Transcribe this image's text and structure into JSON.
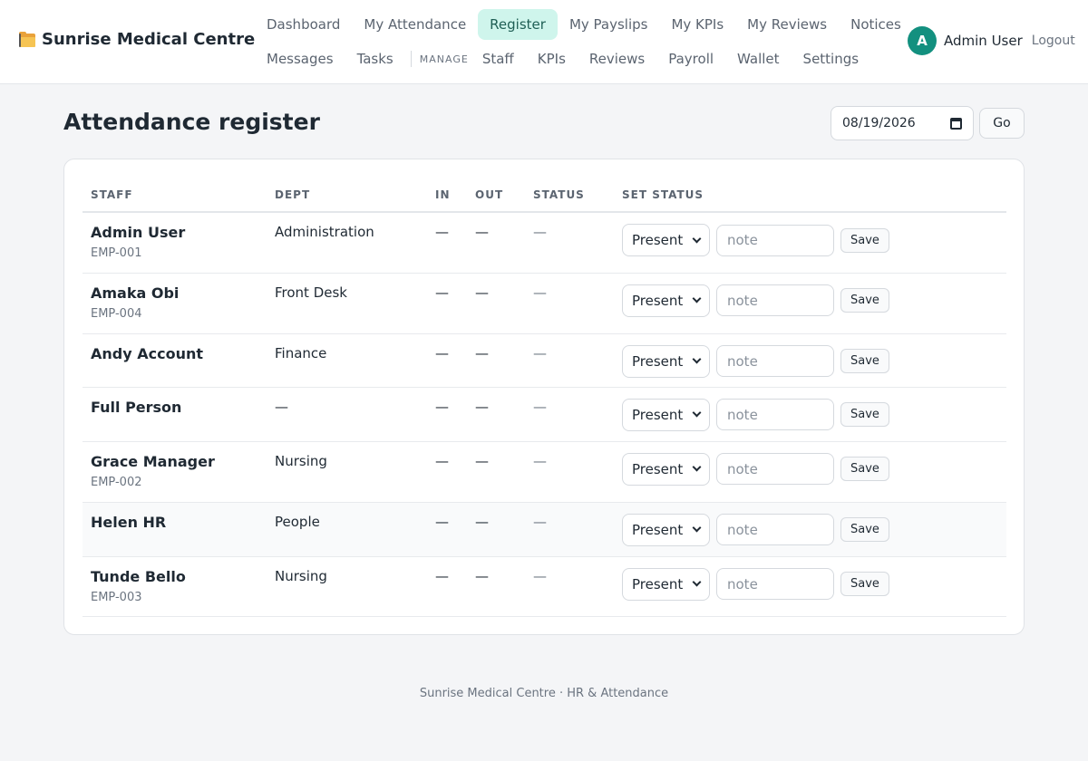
{
  "brand": {
    "name": "Sunrise Medical Centre",
    "icon": "folder-icon"
  },
  "nav": {
    "row1": [
      {
        "label": "Dashboard",
        "active": false
      },
      {
        "label": "My Attendance",
        "active": false
      },
      {
        "label": "Register",
        "active": true
      },
      {
        "label": "My Payslips",
        "active": false
      },
      {
        "label": "My KPIs",
        "active": false
      },
      {
        "label": "My Reviews",
        "active": false
      },
      {
        "label": "Notices",
        "active": false
      }
    ],
    "row2": [
      {
        "label": "Messages"
      },
      {
        "label": "Tasks"
      }
    ],
    "manage_label": "MANAGE",
    "manage": [
      {
        "label": "Staff"
      },
      {
        "label": "KPIs"
      },
      {
        "label": "Reviews"
      },
      {
        "label": "Payroll"
      },
      {
        "label": "Wallet"
      },
      {
        "label": "Settings"
      }
    ]
  },
  "user": {
    "initial": "A",
    "name": "Admin User",
    "logout": "Logout"
  },
  "page": {
    "title": "Attendance register",
    "date_value": "08/19/2026",
    "go_label": "Go"
  },
  "table": {
    "headers": [
      "STAFF",
      "DEPT",
      "IN",
      "OUT",
      "STATUS",
      "SET STATUS"
    ],
    "rows": [
      {
        "name": "Admin User",
        "code": "EMP-001",
        "dept": "Administration",
        "in": "—",
        "out": "—",
        "status": "—",
        "set_status": "Present",
        "note_placeholder": "note",
        "save": "Save"
      },
      {
        "name": "Amaka Obi",
        "code": "EMP-004",
        "dept": "Front Desk",
        "in": "—",
        "out": "—",
        "status": "—",
        "set_status": "Present",
        "note_placeholder": "note",
        "save": "Save"
      },
      {
        "name": "Andy Account",
        "code": "",
        "dept": "Finance",
        "in": "—",
        "out": "—",
        "status": "—",
        "set_status": "Present",
        "note_placeholder": "note",
        "save": "Save"
      },
      {
        "name": "Full Person",
        "code": "",
        "dept": "—",
        "in": "—",
        "out": "—",
        "status": "—",
        "set_status": "Present",
        "note_placeholder": "note",
        "save": "Save"
      },
      {
        "name": "Grace Manager",
        "code": "EMP-002",
        "dept": "Nursing",
        "in": "—",
        "out": "—",
        "status": "—",
        "set_status": "Present",
        "note_placeholder": "note",
        "save": "Save"
      },
      {
        "name": "Helen HR",
        "code": "",
        "dept": "People",
        "in": "—",
        "out": "—",
        "status": "—",
        "set_status": "Present",
        "note_placeholder": "note",
        "save": "Save",
        "highlighted": true
      },
      {
        "name": "Tunde Bello",
        "code": "EMP-003",
        "dept": "Nursing",
        "in": "—",
        "out": "—",
        "status": "—",
        "set_status": "Present",
        "note_placeholder": "note",
        "save": "Save"
      }
    ]
  },
  "footer": {
    "text": "Sunrise Medical Centre · HR & Attendance"
  },
  "colors": {
    "accent": "#13907f",
    "active_nav_bg": "#cff5ec",
    "page_bg": "#f4f5f7"
  }
}
